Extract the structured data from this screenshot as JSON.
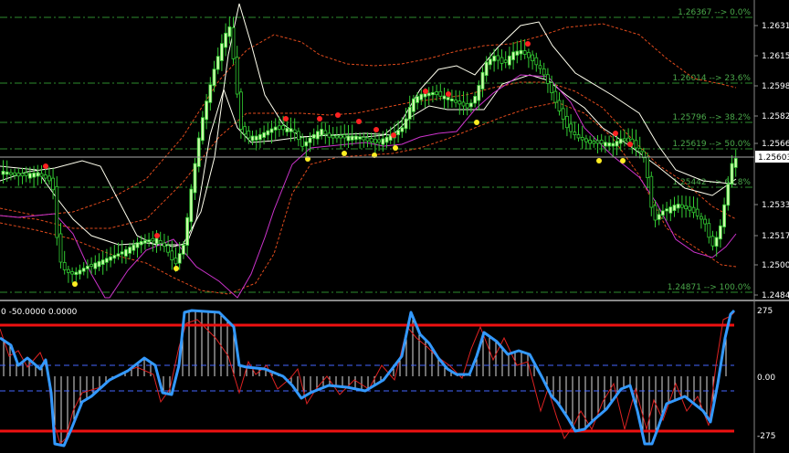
{
  "colors": {
    "background": "#000000",
    "bull_candle": "#ccffaa",
    "bear_candle": "#33cc33",
    "fib_line": "#2e8b2e",
    "fib_text": "#4aa84a",
    "bb_band": "#e04a1c",
    "white_line": "#ffffee",
    "magenta_line": "#cc33cc",
    "cci_line": "#3399ff",
    "signal_line": "#dd2222",
    "level_line": "#ee1111",
    "dash_line": "#4466ff",
    "hist": "#dddddd",
    "dot_red": "#ff2222",
    "dot_yellow": "#ffee22"
  },
  "main_chart": {
    "price_axis": {
      "ticks": [
        "1.26315",
        "1.26150",
        "1.25985",
        "1.25825",
        "1.25660",
        "1.25335",
        "1.25170",
        "1.25005",
        "1.24840"
      ],
      "current_price": "1.25603"
    },
    "fib_levels": [
      {
        "label": "1.26367 --> 0.0%",
        "price": 1.26367
      },
      {
        "label": "1.26014 --> 23.6%",
        "price": 1.26014
      },
      {
        "label": "1.25796 --> 38.2%",
        "price": 1.25796
      },
      {
        "label": "1.25619 --> 50.0%",
        "price": 1.25619
      },
      {
        "label": "1.25442 --> 61.8%",
        "price": 1.25442
      },
      {
        "label": "1.24871 --> 100.0%",
        "price": 1.24871
      }
    ]
  },
  "sub_chart": {
    "header": "0 -50.0000 0.0000",
    "ticks": [
      "275",
      "0.00",
      "-275"
    ]
  }
}
